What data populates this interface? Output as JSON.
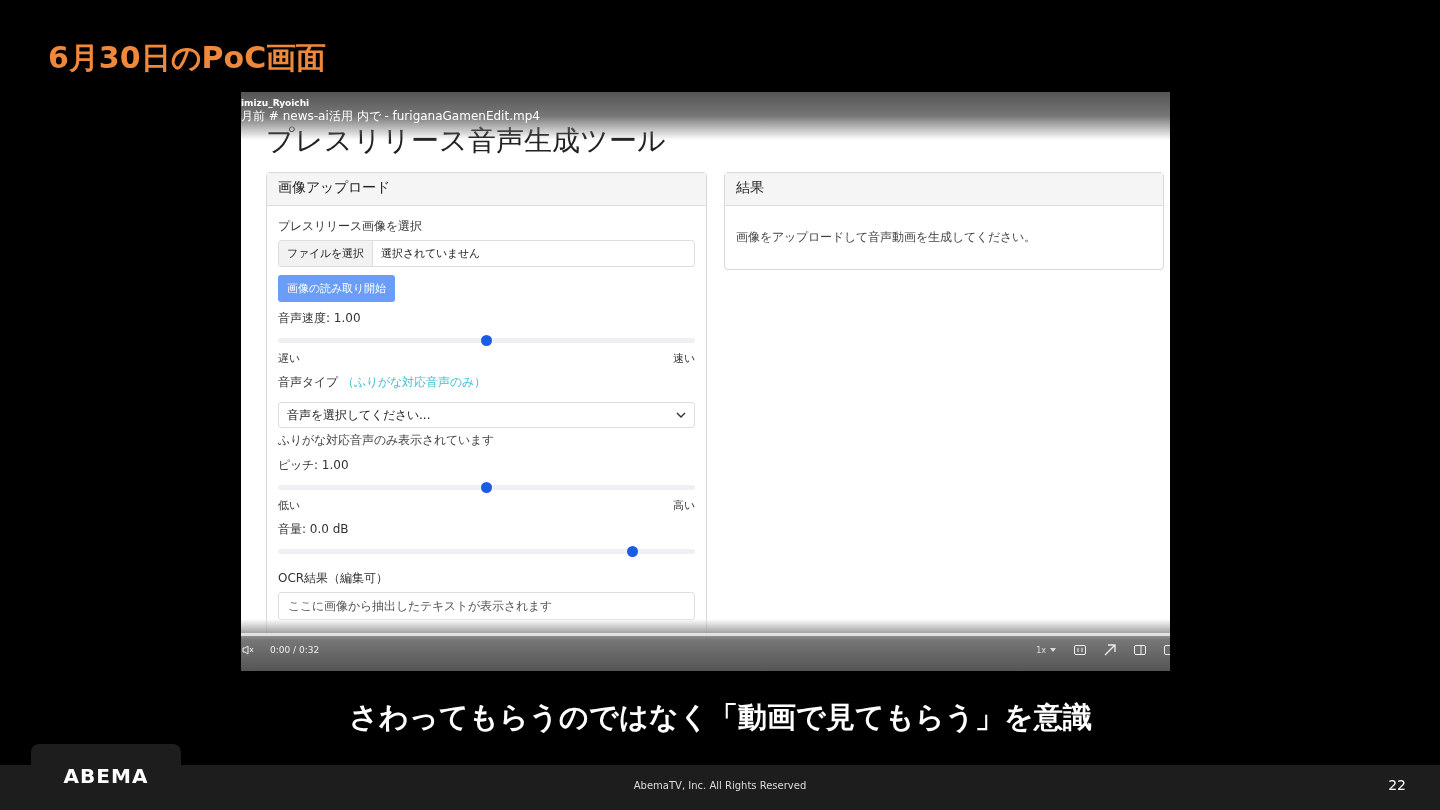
{
  "slide": {
    "title": "6月30日のPoC画面",
    "caption": "さわってもらうのではなく「動画で見てもらう」を意識",
    "logo": "ABEMA",
    "copyright": "AbemaTV, Inc. All Rights Reserved",
    "page_number": "22"
  },
  "video": {
    "uploader": "imizu_Ryoichi",
    "meta": "月前 # news-ai活用 内で - furiganaGamenEdit.mp4",
    "time": "0:00 / 0:32",
    "speed": "1x"
  },
  "app": {
    "title": "プレスリリース音声生成ツール",
    "upload_panel": {
      "header": "画像アップロード",
      "fields": [
        {
          "kind": "file",
          "label": "プレスリリース画像を選択",
          "button": "ファイルを選択",
          "status": "選択されていません"
        },
        {
          "kind": "button",
          "label": "画像の読み取り開始",
          "disabled": true
        },
        {
          "kind": "slider",
          "label": "音声速度: 1.00",
          "level": 0.5,
          "min_label": "遅い",
          "max_label": "速い"
        },
        {
          "kind": "select",
          "label": "音声タイプ",
          "note": "（ふりがな対応音声のみ）",
          "placeholder": "音声を選択してください...",
          "hint": "ふりがな対応音声のみ表示されています"
        },
        {
          "kind": "slider",
          "label": "ピッチ: 1.00",
          "level": 0.5,
          "min_label": "低い",
          "max_label": "高い"
        },
        {
          "kind": "slider",
          "label": "音量: 0.0 dB",
          "level": 0.85
        },
        {
          "kind": "textarea",
          "label": "OCR結果（編集可）",
          "placeholder": "ここに画像から抽出したテキストが表示されます"
        }
      ]
    },
    "result_panel": {
      "header": "結果",
      "message": "画像をアップロードして音声動画を生成してください。"
    }
  }
}
